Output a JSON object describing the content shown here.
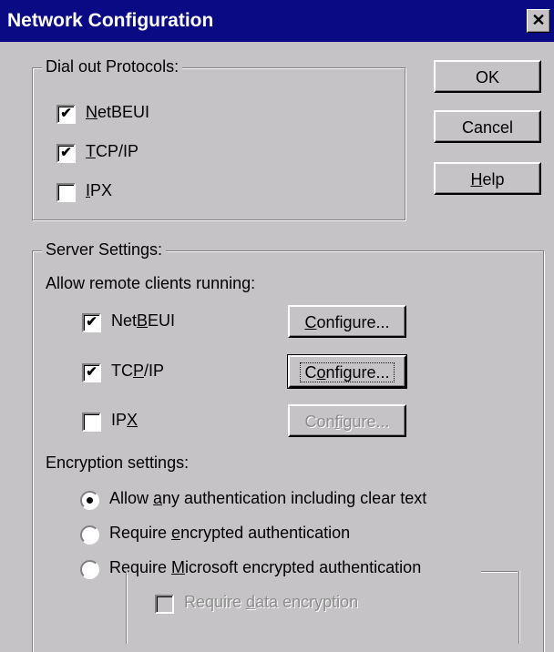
{
  "window": {
    "title": "Network Configuration",
    "close_glyph": "✕"
  },
  "dialout": {
    "legend": "Dial out Protocols:",
    "items": [
      {
        "pre": "",
        "key": "N",
        "post": "etBEUI",
        "checked": true
      },
      {
        "pre": "",
        "key": "T",
        "post": "CP/IP",
        "checked": true
      },
      {
        "pre": "",
        "key": "I",
        "post": "PX",
        "checked": false
      }
    ]
  },
  "buttons": {
    "ok": "OK",
    "cancel": "Cancel",
    "help_key": "H",
    "help_rest": "elp"
  },
  "server": {
    "legend": "Server Settings:",
    "allow_label": "Allow remote clients running:",
    "protocols": [
      {
        "pre": "Net",
        "key": "B",
        "post": "EUI",
        "checked": true,
        "configure_pre": "",
        "configure_key": "C",
        "configure_post": "onfigure...",
        "configure_enabled": true
      },
      {
        "pre": "TC",
        "key": "P",
        "post": "/IP",
        "checked": true,
        "configure_pre": "C",
        "configure_key": "o",
        "configure_post": "nfigure...",
        "configure_enabled": true
      },
      {
        "pre": "IP",
        "key": "X",
        "post": "",
        "checked": false,
        "configure_pre": "Con",
        "configure_key": "f",
        "configure_post": "igure...",
        "configure_enabled": false
      }
    ],
    "encryption_label": "Encryption settings:",
    "encryption_options": [
      {
        "pre": "Allow ",
        "key": "a",
        "post": "ny authentication including clear text",
        "selected": true
      },
      {
        "pre": "Require ",
        "key": "e",
        "post": "ncrypted authentication",
        "selected": false
      },
      {
        "pre": "Require ",
        "key": "M",
        "post": "icrosoft encrypted authentication",
        "selected": false
      }
    ],
    "data_encryption": {
      "pre": "Require ",
      "key": "d",
      "post": "ata encryption",
      "checked": false,
      "enabled": false
    }
  }
}
